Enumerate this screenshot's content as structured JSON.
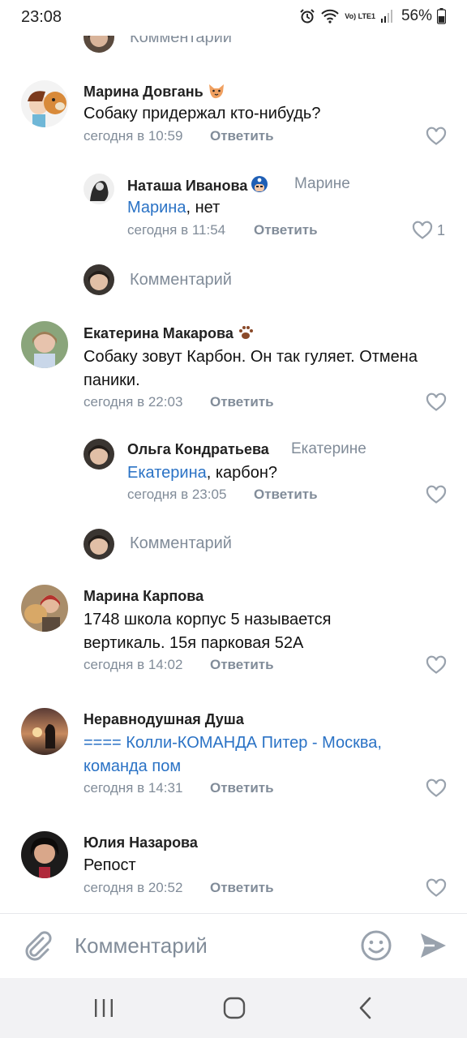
{
  "status": {
    "time": "23:08",
    "network": "Vo) LTE1",
    "battery": "56%"
  },
  "comments": [
    {
      "type": "composer",
      "placeholder": "Комментарии"
    },
    {
      "type": "comment",
      "author": "Марина Довгань",
      "text": "Собаку придержал кто-нибудь?",
      "time": "сегодня в 10:59",
      "reply_label": "Ответить"
    },
    {
      "type": "reply",
      "author": "Наташа Иванова",
      "reply_to": "Марине",
      "mention": "Марина",
      "text_rest": ", нет",
      "time": "сегодня в 11:54",
      "reply_label": "Ответить",
      "likes": "1"
    },
    {
      "type": "composer",
      "placeholder": "Комментарий"
    },
    {
      "type": "comment",
      "author": "Екатерина Макарова",
      "text_line1": "Собаку зовут Карбон. Он так гуляет. Отмена",
      "text_line2": "паники.",
      "time": "сегодня в 22:03",
      "reply_label": "Ответить"
    },
    {
      "type": "reply",
      "author": "Ольга Кондратьева",
      "reply_to": "Екатерине",
      "mention": "Екатерина",
      "text_rest": ", карбон?",
      "time": "сегодня в 23:05",
      "reply_label": "Ответить"
    },
    {
      "type": "composer",
      "placeholder": "Комментарий"
    },
    {
      "type": "comment",
      "author": "Марина Карпова",
      "text_line1": "1748 школа корпус 5 называется",
      "text_line2": "вертикаль. 15я парковая 52А",
      "time": "сегодня в 14:02",
      "reply_label": "Ответить"
    },
    {
      "type": "comment",
      "author": "Неравнодушная Душа",
      "link_line1": "==== Колли-КОМАНДА   Питер - Москва,",
      "link_line2": "команда пом",
      "time": "сегодня в 14:31",
      "reply_label": "Ответить"
    },
    {
      "type": "comment",
      "author": "Юлия Назарова",
      "text": "Репост",
      "time": "сегодня в 20:52",
      "reply_label": "Ответить"
    }
  ],
  "input": {
    "placeholder": "Комментарий"
  },
  "icons": {
    "attach": "paperclip-icon",
    "emoji": "smile-icon",
    "send": "send-icon",
    "like": "heart-icon"
  },
  "colors": {
    "link": "#2a72c5",
    "secondary": "#818c99",
    "text": "#222222"
  }
}
